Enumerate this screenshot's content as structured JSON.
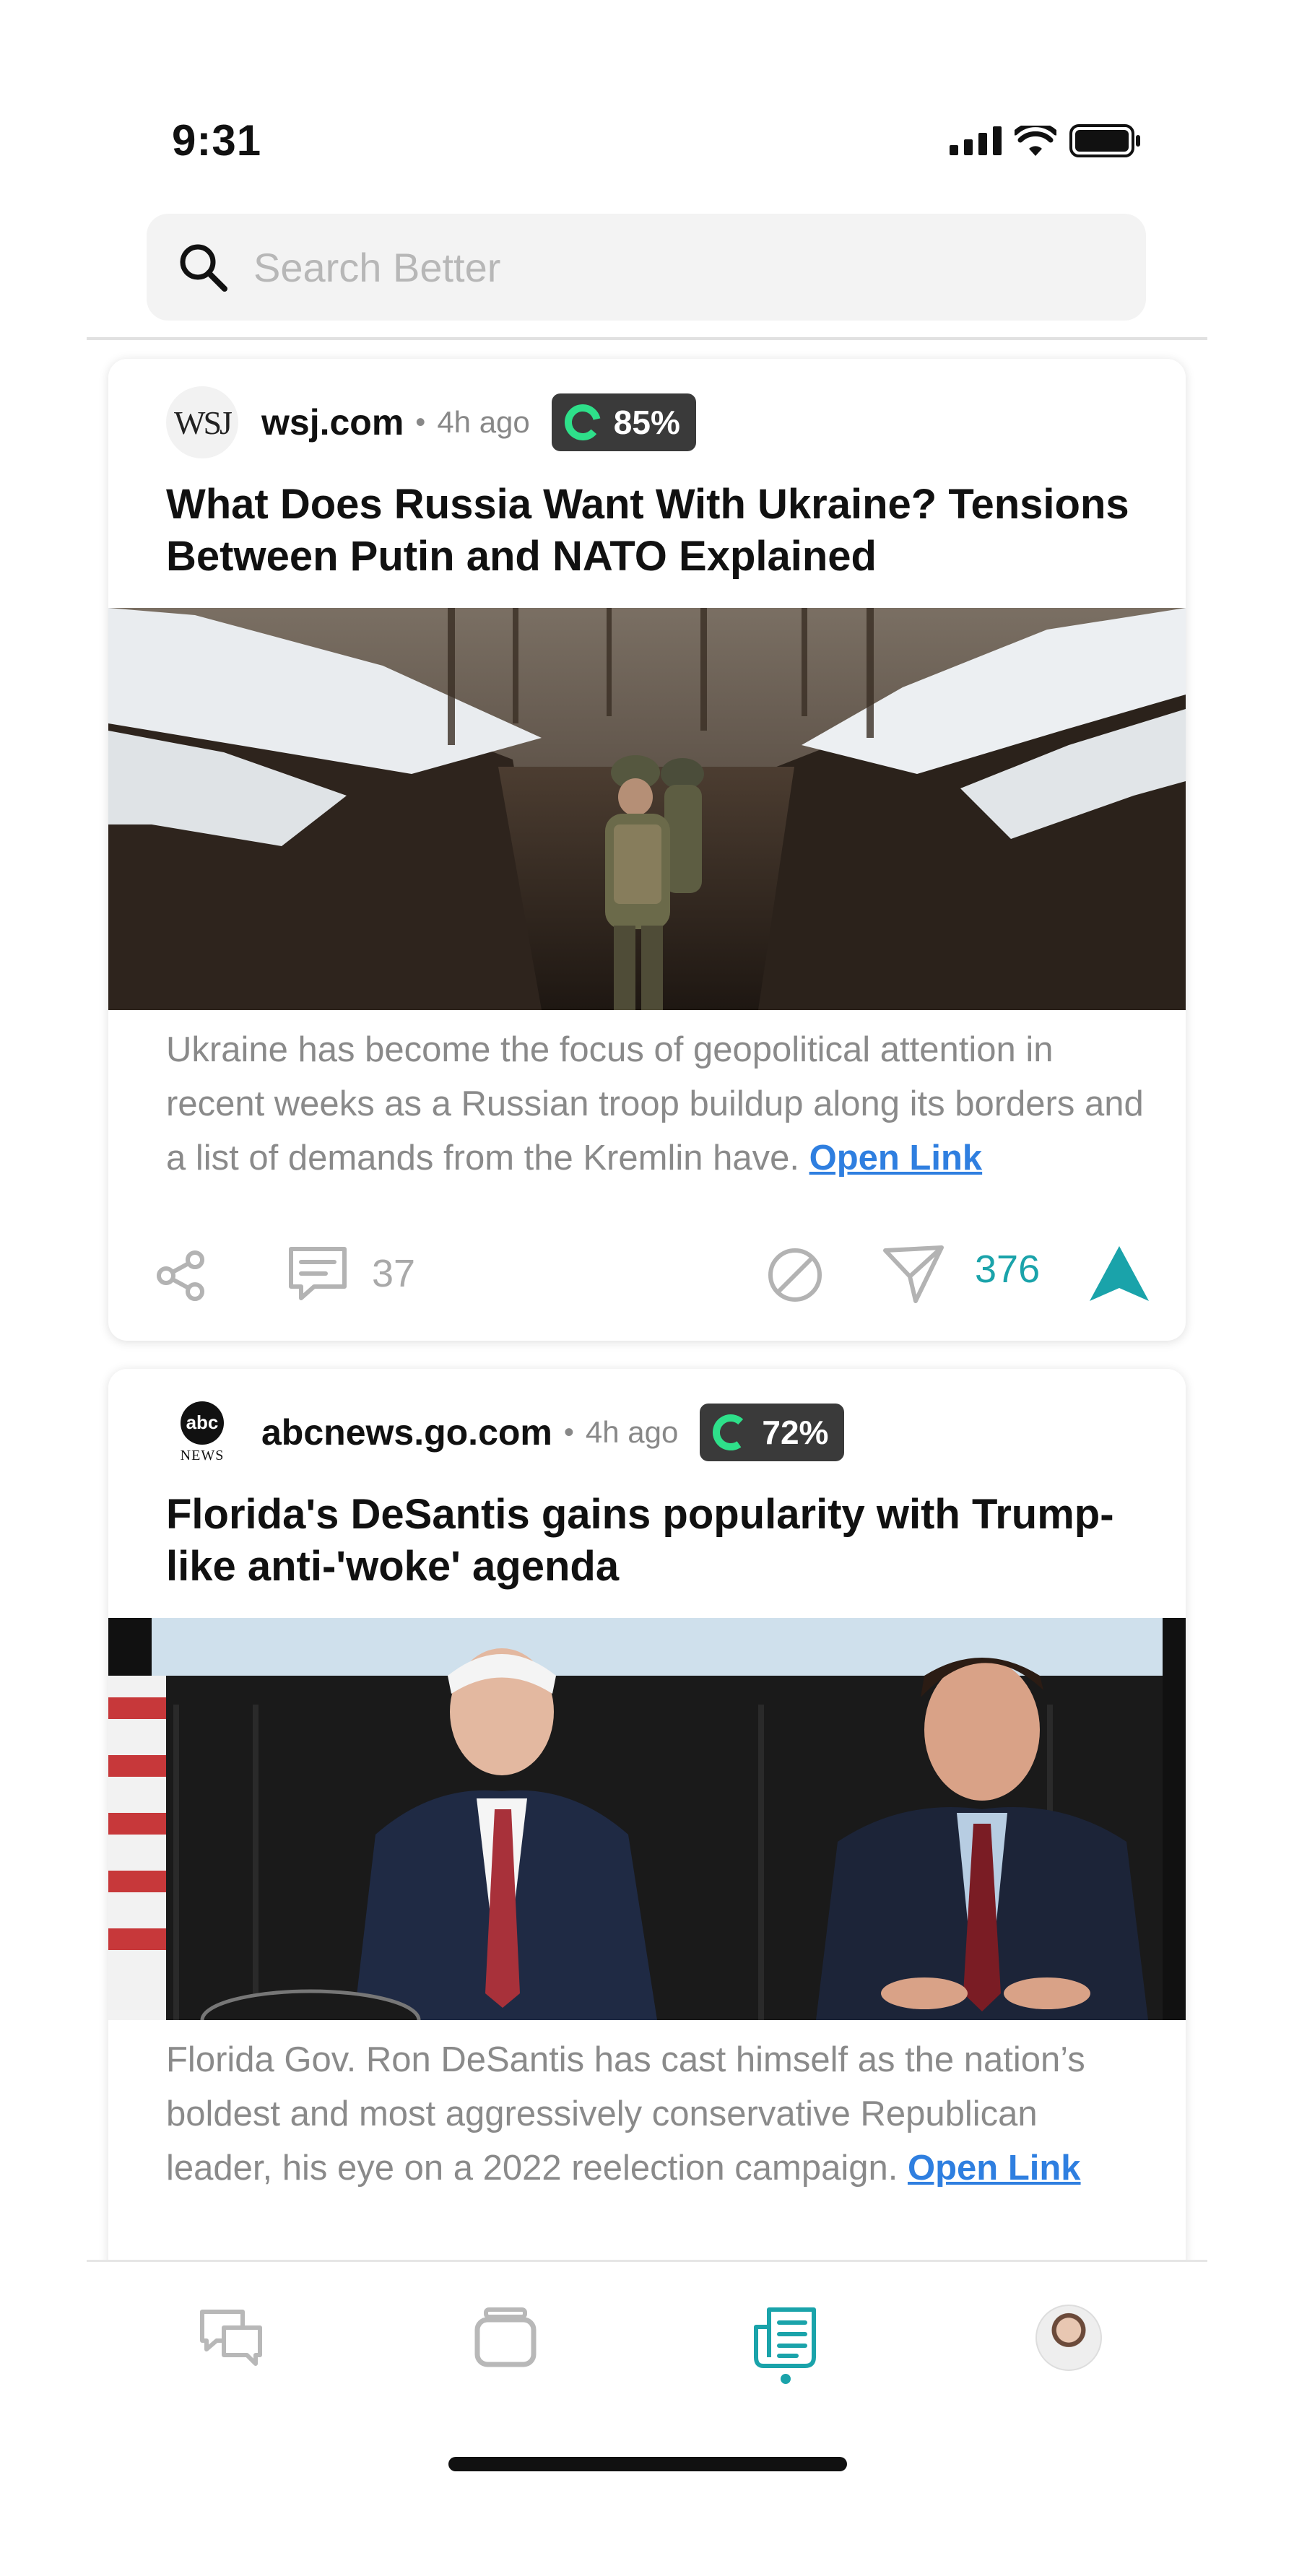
{
  "status_bar": {
    "time": "9:31"
  },
  "search": {
    "placeholder": "Search Better"
  },
  "articles": [
    {
      "source": "wsj.com",
      "logo_text": "WSJ",
      "time_ago": "4h ago",
      "score": "85%",
      "headline": "What Does Russia Want With Ukraine? Tensions Between Putin and NATO Explained",
      "summary": "Ukraine has become the focus of geopolitical attention in recent weeks as a Russian troop buildup along its borders and a list of demands from the Kremlin have.",
      "link_label": "Open Link",
      "comments": "37",
      "votes": "376",
      "image": "soldiers-in-snowy-trench"
    },
    {
      "source": "abcnews.go.com",
      "logo_text": "abc",
      "logo_subtext": "NEWS",
      "time_ago": "4h ago",
      "score": "72%",
      "headline": "Florida's DeSantis gains popularity with Trump-like anti-'woke' agenda",
      "summary": "Florida Gov. Ron DeSantis has cast himself as the nation’s boldest and most aggressively conservative Republican leader, his eye on a 2022 reelection campaign.",
      "link_label": "Open Link",
      "image": "two-men-at-press-table"
    }
  ],
  "tabbar": {
    "tabs": [
      "chat-icon",
      "cards-icon",
      "news-feed-icon",
      "profile-avatar"
    ],
    "active": "news-feed-icon"
  },
  "colors": {
    "accent": "#1aa3aa",
    "link": "#2f7fe0",
    "badge": "#3a3a3a",
    "score_ring": "#2ee08a"
  }
}
